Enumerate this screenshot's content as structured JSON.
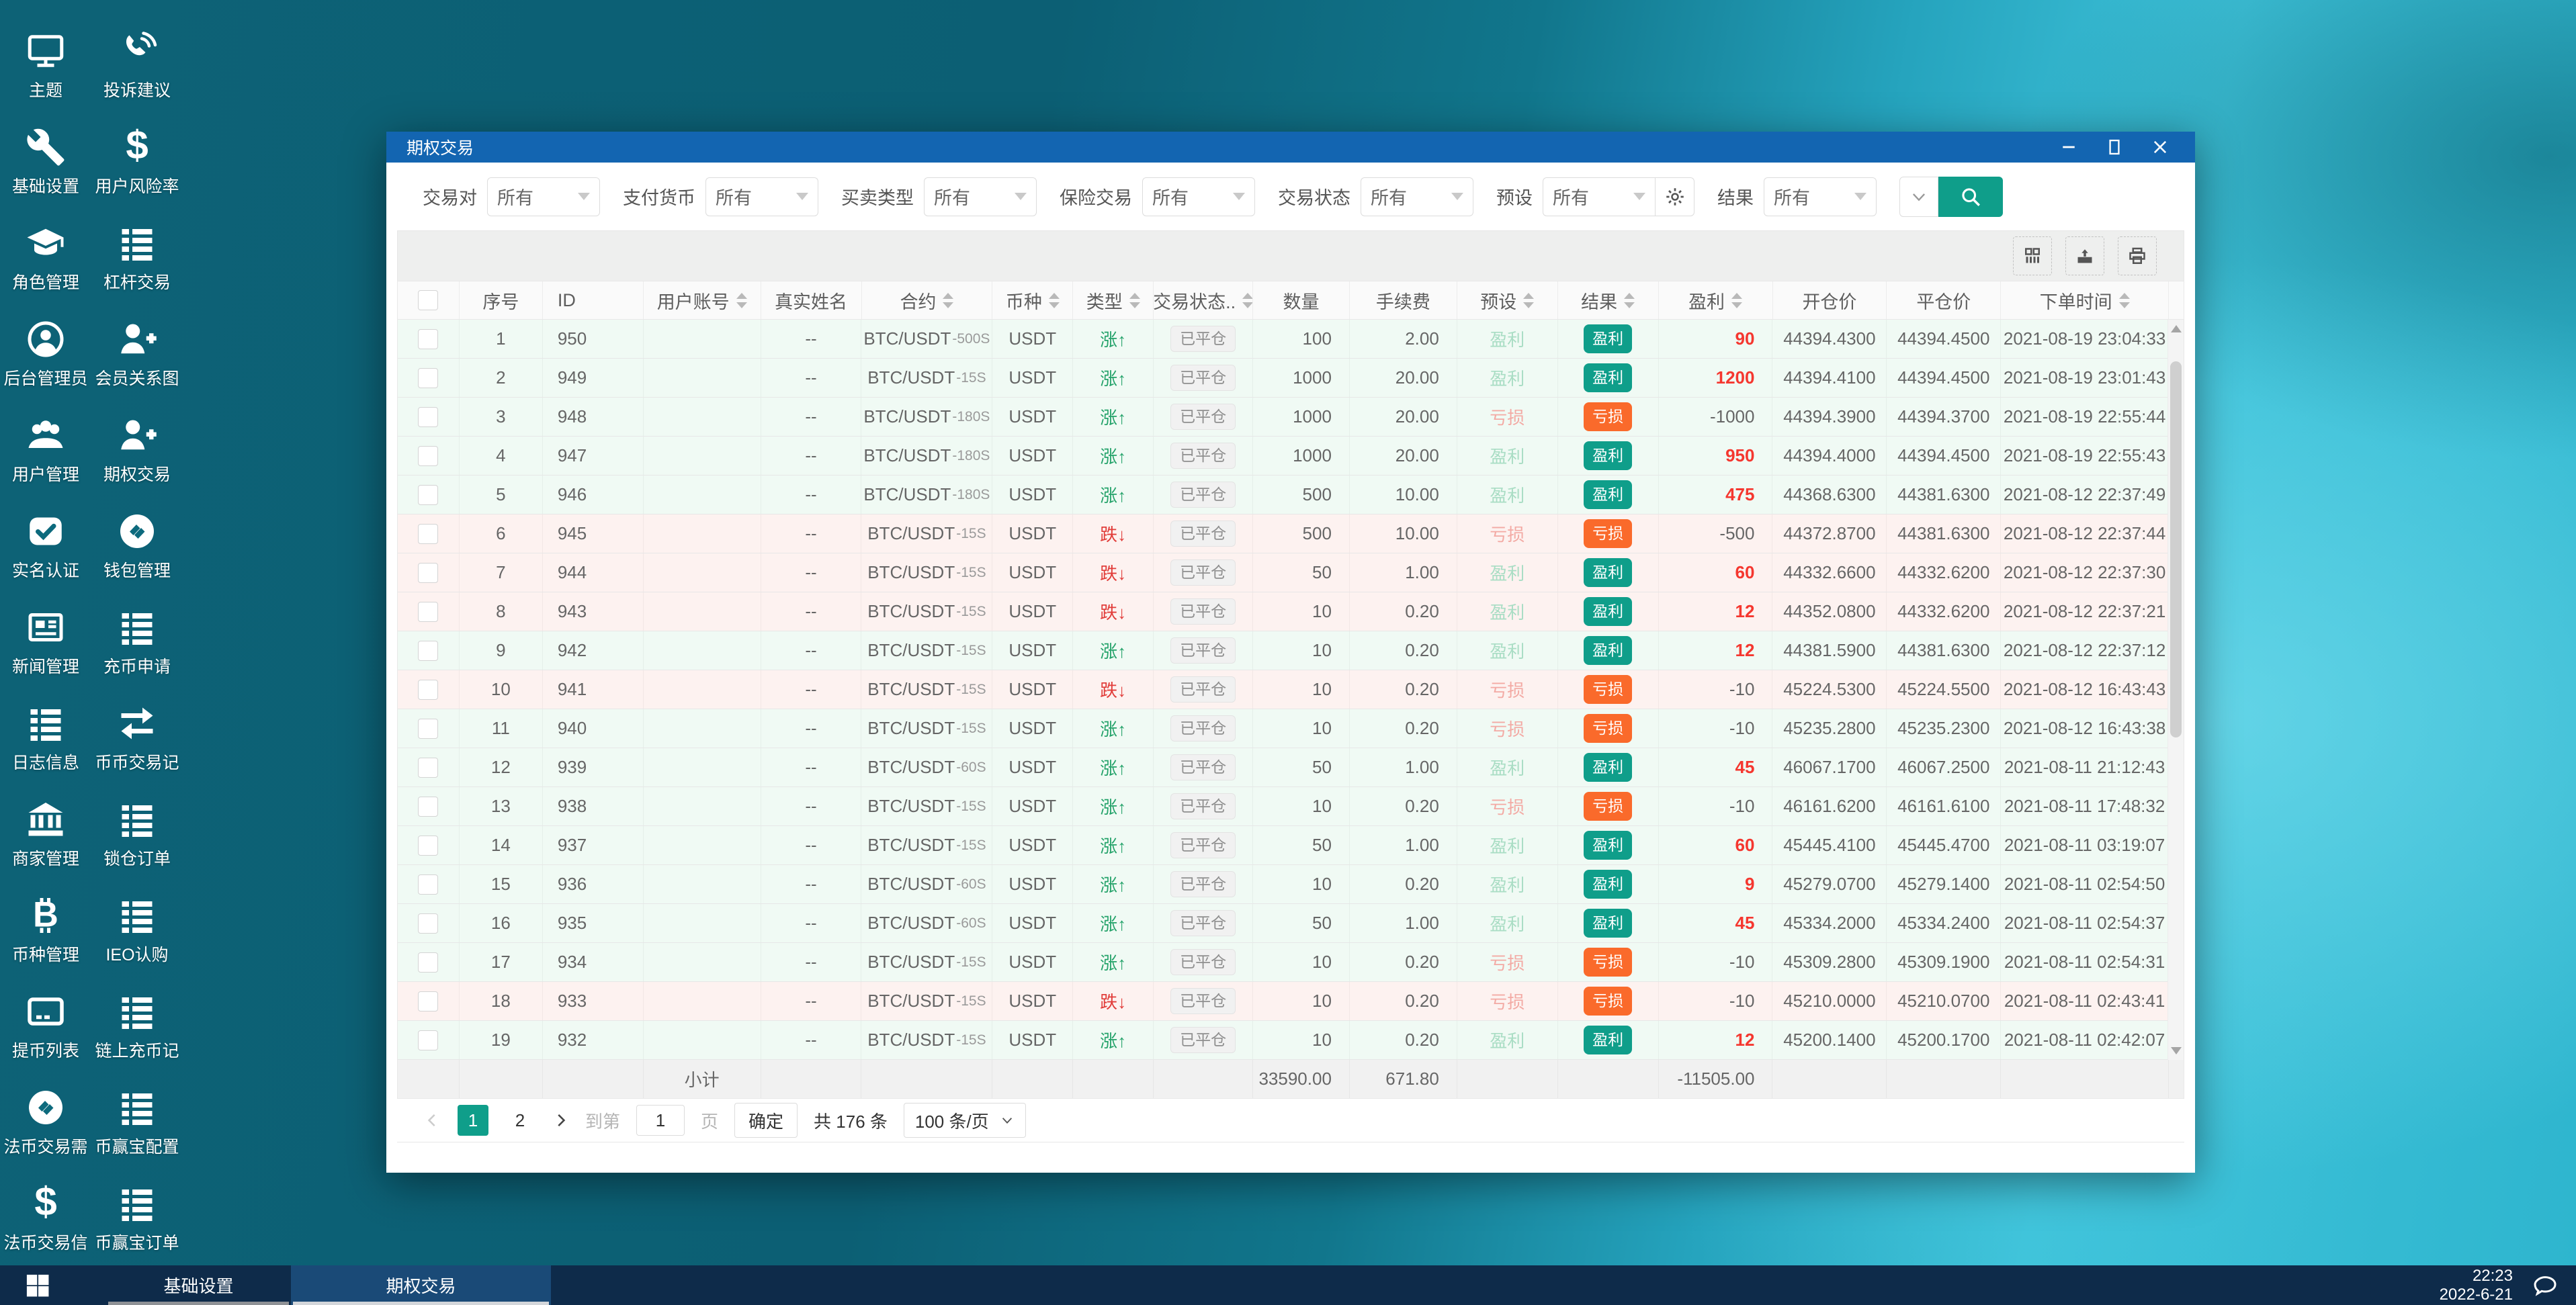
{
  "desktop": {
    "icons": [
      {
        "label": "主题",
        "icon": "monitor-icon"
      },
      {
        "label": "投诉建议",
        "icon": "phone-icon"
      },
      {
        "label": "基础设置",
        "icon": "wrench-icon"
      },
      {
        "label": "用户风险率",
        "icon": "dollar-icon"
      },
      {
        "label": "角色管理",
        "icon": "graduation-cap-icon"
      },
      {
        "label": "杠杆交易",
        "icon": "list-icon"
      },
      {
        "label": "后台管理员",
        "icon": "admin-user-icon"
      },
      {
        "label": "会员关系图",
        "icon": "user-plus-icon"
      },
      {
        "label": "用户管理",
        "icon": "users-icon"
      },
      {
        "label": "期权交易",
        "icon": "user-plus-icon"
      },
      {
        "label": "实名认证",
        "icon": "check-badge-icon"
      },
      {
        "label": "钱包管理",
        "icon": "wallet-icon"
      },
      {
        "label": "新闻管理",
        "icon": "newspaper-icon"
      },
      {
        "label": "充币申请",
        "icon": "list-icon"
      },
      {
        "label": "日志信息",
        "icon": "list-icon"
      },
      {
        "label": "币币交易记",
        "icon": "exchange-icon"
      },
      {
        "label": "商家管理",
        "icon": "bank-icon"
      },
      {
        "label": "锁仓订单",
        "icon": "list-icon"
      },
      {
        "label": "币种管理",
        "icon": "bitcoin-icon"
      },
      {
        "label": "IEO认购",
        "icon": "list-icon"
      },
      {
        "label": "提币列表",
        "icon": "card-icon"
      },
      {
        "label": "链上充币记",
        "icon": "list-icon"
      },
      {
        "label": "法币交易需",
        "icon": "wallet-icon"
      },
      {
        "label": "币赢宝配置",
        "icon": "list-icon"
      },
      {
        "label": "法币交易信",
        "icon": "dollar-icon"
      },
      {
        "label": "币赢宝订单",
        "icon": "list-icon"
      }
    ]
  },
  "window": {
    "title": "期权交易",
    "controls": [
      "minimize-icon",
      "maximize-icon",
      "close-icon"
    ],
    "filters": {
      "fields": [
        {
          "label": "交易对",
          "value": "所有"
        },
        {
          "label": "支付货币",
          "value": "所有"
        },
        {
          "label": "买卖类型",
          "value": "所有"
        },
        {
          "label": "保险交易",
          "value": "所有"
        },
        {
          "label": "交易状态",
          "value": "所有"
        },
        {
          "label": "预设",
          "value": "所有",
          "suffix_icon": "gear-icon"
        },
        {
          "label": "结果",
          "value": "所有"
        }
      ],
      "collapse_icon": "chevron-down-icon",
      "search_icon": "search-icon"
    },
    "toolbar_icons": [
      "columns-icon",
      "export-icon",
      "print-icon"
    ],
    "table": {
      "headers": [
        {
          "label": "",
          "checkbox": true
        },
        {
          "label": "序号"
        },
        {
          "label": "ID"
        },
        {
          "label": "用户账号",
          "sortable": true
        },
        {
          "label": "真实姓名"
        },
        {
          "label": "合约",
          "sortable": true
        },
        {
          "label": "币种",
          "sortable": true
        },
        {
          "label": "类型",
          "sortable": true
        },
        {
          "label": "交易状态..",
          "sortable": true
        },
        {
          "label": "数量"
        },
        {
          "label": "手续费"
        },
        {
          "label": "预设",
          "sortable": true
        },
        {
          "label": "结果",
          "sortable": true
        },
        {
          "label": "盈利",
          "sortable": true
        },
        {
          "label": "开仓价"
        },
        {
          "label": "平仓价"
        },
        {
          "label": "下单时间",
          "sortable": true
        }
      ],
      "rows": [
        {
          "no": "1",
          "id": "950",
          "account": "",
          "name": "--",
          "contract": "BTC/USDT",
          "period": "-500S",
          "coin": "USDT",
          "type": "涨",
          "dir": "up",
          "status": "已平仓",
          "amount": "100",
          "fee": "2.00",
          "preset": "盈利",
          "result": "盈利",
          "profit": "90",
          "open": "44394.4300",
          "close": "44394.4500",
          "time": "2021-08-19 23:04:33"
        },
        {
          "no": "2",
          "id": "949",
          "account": "",
          "name": "--",
          "contract": "BTC/USDT",
          "period": "-15S",
          "coin": "USDT",
          "type": "涨",
          "dir": "up",
          "status": "已平仓",
          "amount": "1000",
          "fee": "20.00",
          "preset": "盈利",
          "result": "盈利",
          "profit": "1200",
          "open": "44394.4100",
          "close": "44394.4500",
          "time": "2021-08-19 23:01:43"
        },
        {
          "no": "3",
          "id": "948",
          "account": "",
          "name": "--",
          "contract": "BTC/USDT",
          "period": "-180S",
          "coin": "USDT",
          "type": "涨",
          "dir": "up",
          "status": "已平仓",
          "amount": "1000",
          "fee": "20.00",
          "preset": "亏损",
          "result": "亏损",
          "profit": "-1000",
          "open": "44394.3900",
          "close": "44394.3700",
          "time": "2021-08-19 22:55:44"
        },
        {
          "no": "4",
          "id": "947",
          "account": "",
          "name": "--",
          "contract": "BTC/USDT",
          "period": "-180S",
          "coin": "USDT",
          "type": "涨",
          "dir": "up",
          "status": "已平仓",
          "amount": "1000",
          "fee": "20.00",
          "preset": "盈利",
          "result": "盈利",
          "profit": "950",
          "open": "44394.4000",
          "close": "44394.4500",
          "time": "2021-08-19 22:55:43"
        },
        {
          "no": "5",
          "id": "946",
          "account": "",
          "name": "--",
          "contract": "BTC/USDT",
          "period": "-180S",
          "coin": "USDT",
          "type": "涨",
          "dir": "up",
          "status": "已平仓",
          "amount": "500",
          "fee": "10.00",
          "preset": "盈利",
          "result": "盈利",
          "profit": "475",
          "open": "44368.6300",
          "close": "44381.6300",
          "time": "2021-08-12 22:37:49"
        },
        {
          "no": "6",
          "id": "945",
          "account": "",
          "name": "--",
          "contract": "BTC/USDT",
          "period": "-15S",
          "coin": "USDT",
          "type": "跌",
          "dir": "down",
          "status": "已平仓",
          "amount": "500",
          "fee": "10.00",
          "preset": "亏损",
          "result": "亏损",
          "profit": "-500",
          "open": "44372.8700",
          "close": "44381.6300",
          "time": "2021-08-12 22:37:44"
        },
        {
          "no": "7",
          "id": "944",
          "account": "",
          "name": "--",
          "contract": "BTC/USDT",
          "period": "-15S",
          "coin": "USDT",
          "type": "跌",
          "dir": "down",
          "status": "已平仓",
          "amount": "50",
          "fee": "1.00",
          "preset": "盈利",
          "result": "盈利",
          "profit": "60",
          "open": "44332.6600",
          "close": "44332.6200",
          "time": "2021-08-12 22:37:30"
        },
        {
          "no": "8",
          "id": "943",
          "account": "",
          "name": "--",
          "contract": "BTC/USDT",
          "period": "-15S",
          "coin": "USDT",
          "type": "跌",
          "dir": "down",
          "status": "已平仓",
          "amount": "10",
          "fee": "0.20",
          "preset": "盈利",
          "result": "盈利",
          "profit": "12",
          "open": "44352.0800",
          "close": "44332.6200",
          "time": "2021-08-12 22:37:21"
        },
        {
          "no": "9",
          "id": "942",
          "account": "",
          "name": "--",
          "contract": "BTC/USDT",
          "period": "-15S",
          "coin": "USDT",
          "type": "涨",
          "dir": "up",
          "status": "已平仓",
          "amount": "10",
          "fee": "0.20",
          "preset": "盈利",
          "result": "盈利",
          "profit": "12",
          "open": "44381.5900",
          "close": "44381.6300",
          "time": "2021-08-12 22:37:12"
        },
        {
          "no": "10",
          "id": "941",
          "account": "",
          "name": "--",
          "contract": "BTC/USDT",
          "period": "-15S",
          "coin": "USDT",
          "type": "跌",
          "dir": "down",
          "status": "已平仓",
          "amount": "10",
          "fee": "0.20",
          "preset": "亏损",
          "result": "亏损",
          "profit": "-10",
          "open": "45224.5300",
          "close": "45224.5500",
          "time": "2021-08-12 16:43:43"
        },
        {
          "no": "11",
          "id": "940",
          "account": "",
          "name": "--",
          "contract": "BTC/USDT",
          "period": "-15S",
          "coin": "USDT",
          "type": "涨",
          "dir": "up",
          "status": "已平仓",
          "amount": "10",
          "fee": "0.20",
          "preset": "亏损",
          "result": "亏损",
          "profit": "-10",
          "open": "45235.2800",
          "close": "45235.2300",
          "time": "2021-08-12 16:43:38"
        },
        {
          "no": "12",
          "id": "939",
          "account": "",
          "name": "--",
          "contract": "BTC/USDT",
          "period": "-60S",
          "coin": "USDT",
          "type": "涨",
          "dir": "up",
          "status": "已平仓",
          "amount": "50",
          "fee": "1.00",
          "preset": "盈利",
          "result": "盈利",
          "profit": "45",
          "open": "46067.1700",
          "close": "46067.2500",
          "time": "2021-08-11 21:12:43"
        },
        {
          "no": "13",
          "id": "938",
          "account": "",
          "name": "--",
          "contract": "BTC/USDT",
          "period": "-15S",
          "coin": "USDT",
          "type": "涨",
          "dir": "up",
          "status": "已平仓",
          "amount": "10",
          "fee": "0.20",
          "preset": "亏损",
          "result": "亏损",
          "profit": "-10",
          "open": "46161.6200",
          "close": "46161.6100",
          "time": "2021-08-11 17:48:32"
        },
        {
          "no": "14",
          "id": "937",
          "account": "",
          "name": "--",
          "contract": "BTC/USDT",
          "period": "-15S",
          "coin": "USDT",
          "type": "涨",
          "dir": "up",
          "status": "已平仓",
          "amount": "50",
          "fee": "1.00",
          "preset": "盈利",
          "result": "盈利",
          "profit": "60",
          "open": "45445.4100",
          "close": "45445.4700",
          "time": "2021-08-11 03:19:07"
        },
        {
          "no": "15",
          "id": "936",
          "account": "",
          "name": "--",
          "contract": "BTC/USDT",
          "period": "-60S",
          "coin": "USDT",
          "type": "涨",
          "dir": "up",
          "status": "已平仓",
          "amount": "10",
          "fee": "0.20",
          "preset": "盈利",
          "result": "盈利",
          "profit": "9",
          "open": "45279.0700",
          "close": "45279.1400",
          "time": "2021-08-11 02:54:50"
        },
        {
          "no": "16",
          "id": "935",
          "account": "",
          "name": "--",
          "contract": "BTC/USDT",
          "period": "-60S",
          "coin": "USDT",
          "type": "涨",
          "dir": "up",
          "status": "已平仓",
          "amount": "50",
          "fee": "1.00",
          "preset": "盈利",
          "result": "盈利",
          "profit": "45",
          "open": "45334.2000",
          "close": "45334.2400",
          "time": "2021-08-11 02:54:37"
        },
        {
          "no": "17",
          "id": "934",
          "account": "",
          "name": "--",
          "contract": "BTC/USDT",
          "period": "-15S",
          "coin": "USDT",
          "type": "涨",
          "dir": "up",
          "status": "已平仓",
          "amount": "10",
          "fee": "0.20",
          "preset": "亏损",
          "result": "亏损",
          "profit": "-10",
          "open": "45309.2800",
          "close": "45309.1900",
          "time": "2021-08-11 02:54:31"
        },
        {
          "no": "18",
          "id": "933",
          "account": "",
          "name": "--",
          "contract": "BTC/USDT",
          "period": "-15S",
          "coin": "USDT",
          "type": "跌",
          "dir": "down",
          "status": "已平仓",
          "amount": "10",
          "fee": "0.20",
          "preset": "亏损",
          "result": "亏损",
          "profit": "-10",
          "open": "45210.0000",
          "close": "45210.0700",
          "time": "2021-08-11 02:43:41"
        },
        {
          "no": "19",
          "id": "932",
          "account": "",
          "name": "--",
          "contract": "BTC/USDT",
          "period": "-15S",
          "coin": "USDT",
          "type": "涨",
          "dir": "up",
          "status": "已平仓",
          "amount": "10",
          "fee": "0.20",
          "preset": "盈利",
          "result": "盈利",
          "profit": "12",
          "open": "45200.1400",
          "close": "45200.1700",
          "time": "2021-08-11 02:42:07"
        }
      ],
      "subtotal": {
        "label": "小计",
        "amount": "33590.00",
        "fee": "671.80",
        "profit": "-11505.00"
      }
    },
    "pagination": {
      "pages": [
        {
          "label": "1",
          "active": true
        },
        {
          "label": "2",
          "active": false
        }
      ],
      "goto_prefix": "到第",
      "goto_value": "1",
      "goto_suffix": "页",
      "confirm_label": "确定",
      "total_label": "共 176 条",
      "page_size_label": "100 条/页"
    }
  },
  "taskbar": {
    "start_icon": "windows-icon",
    "buttons": [
      {
        "label": "基础设置",
        "active": false
      },
      {
        "label": "期权交易",
        "active": true
      }
    ],
    "clock_time": "22:23",
    "clock_date": "2022-6-21",
    "tray_icon": "chat-icon"
  },
  "colors": {
    "titlebar_blue": "#1365b1",
    "accent_teal": "#0f9e8a",
    "accent_orange": "#fa6a2b",
    "up_green": "#23a269",
    "down_red": "#e13c39",
    "profit_red": "#f5372f",
    "taskbar_navy": "#0e2b4a",
    "taskbar_active": "#1a4a77",
    "row_up_bg": "#f0faf4",
    "row_down_bg": "#fdf2f0"
  }
}
